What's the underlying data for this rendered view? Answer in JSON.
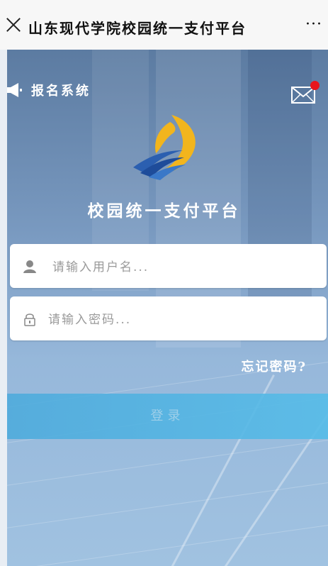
{
  "window": {
    "title": "山东现代学院校园统一支付平台",
    "more_label": "···"
  },
  "header": {
    "system_label": "报名系统"
  },
  "brand": {
    "platform_name": "校园统一支付平台"
  },
  "login": {
    "username_placeholder": "请输入用户名...",
    "username_value": "",
    "password_placeholder": "请输入密码...",
    "password_value": "",
    "forgot_label": "忘记密码?",
    "submit_label": "登录"
  },
  "colors": {
    "notify_dot": "#e8141c",
    "logo_gold": "#f2b51d",
    "logo_blue": "#2b5fb0",
    "button": "#4aaadc"
  },
  "icons": {
    "close": "close-icon",
    "more": "more-icon",
    "megaphone": "megaphone-icon",
    "mail": "mail-icon",
    "user": "user-icon",
    "lock": "lock-icon"
  }
}
